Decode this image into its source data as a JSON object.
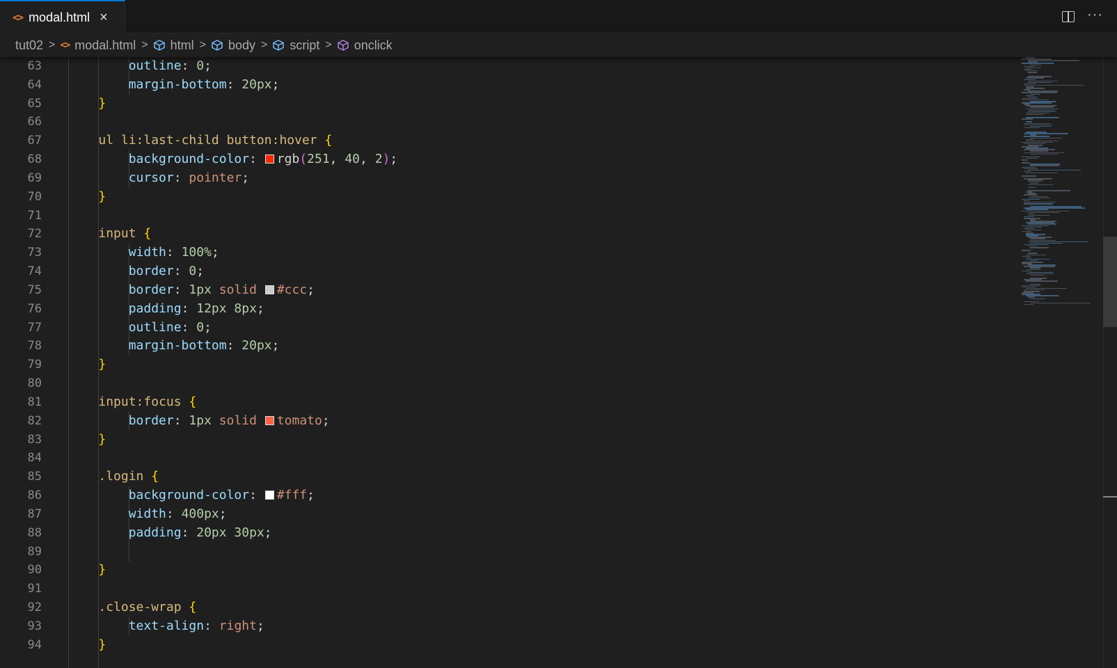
{
  "tab": {
    "label": "modal.html",
    "file_icon": "<>",
    "close_glyph": "×"
  },
  "tabbar_actions": {
    "split_icon": "split-editor-icon",
    "more_glyph": "···"
  },
  "breadcrumbs": {
    "folder": "tut02",
    "file": "modal.html",
    "symbols": [
      "html",
      "body",
      "script"
    ],
    "method": "onclick"
  },
  "colors": {
    "swatch_red": "#fb2802",
    "swatch_ccc": "#cccccc",
    "swatch_tomato": "#ff6347",
    "swatch_fff": "#ffffff"
  },
  "line_numbers": [
    "63",
    "64",
    "65",
    "66",
    "67",
    "68",
    "69",
    "70",
    "71",
    "72",
    "73",
    "74",
    "75",
    "76",
    "77",
    "78",
    "79",
    "80",
    "81",
    "82",
    "83",
    "84",
    "85",
    "86",
    "87",
    "88",
    "89",
    "90",
    "91",
    "92",
    "93",
    "94"
  ],
  "code": {
    "l63": {
      "prop": "outline",
      "num": "0"
    },
    "l64": {
      "prop": "margin-bottom",
      "num": "20px"
    },
    "l67": {
      "sel": "ul li:last-child button:hover"
    },
    "l68": {
      "prop": "background-color",
      "fn": "rgb",
      "a": "251",
      "b": "40",
      "c": "2"
    },
    "l69": {
      "prop": "cursor",
      "val": "pointer"
    },
    "l72": {
      "sel": "input"
    },
    "l73": {
      "prop": "width",
      "num": "100%"
    },
    "l74": {
      "prop": "border",
      "num": "0"
    },
    "l75": {
      "prop": "border",
      "num": "1px",
      "val": "solid",
      "color": "#ccc"
    },
    "l76": {
      "prop": "padding",
      "num": "12px 8px"
    },
    "l77": {
      "prop": "outline",
      "num": "0"
    },
    "l78": {
      "prop": "margin-bottom",
      "num": "20px"
    },
    "l81": {
      "sel": "input:focus"
    },
    "l82": {
      "prop": "border",
      "num": "1px",
      "val": "solid",
      "color": "tomato"
    },
    "l85": {
      "sel": ".login"
    },
    "l86": {
      "prop": "background-color",
      "color": "#fff"
    },
    "l87": {
      "prop": "width",
      "num": "400px"
    },
    "l88": {
      "prop": "padding",
      "num": "20px 30px"
    },
    "l92": {
      "sel": ".close-wrap"
    },
    "l93": {
      "prop": "text-align",
      "val": "right"
    }
  }
}
